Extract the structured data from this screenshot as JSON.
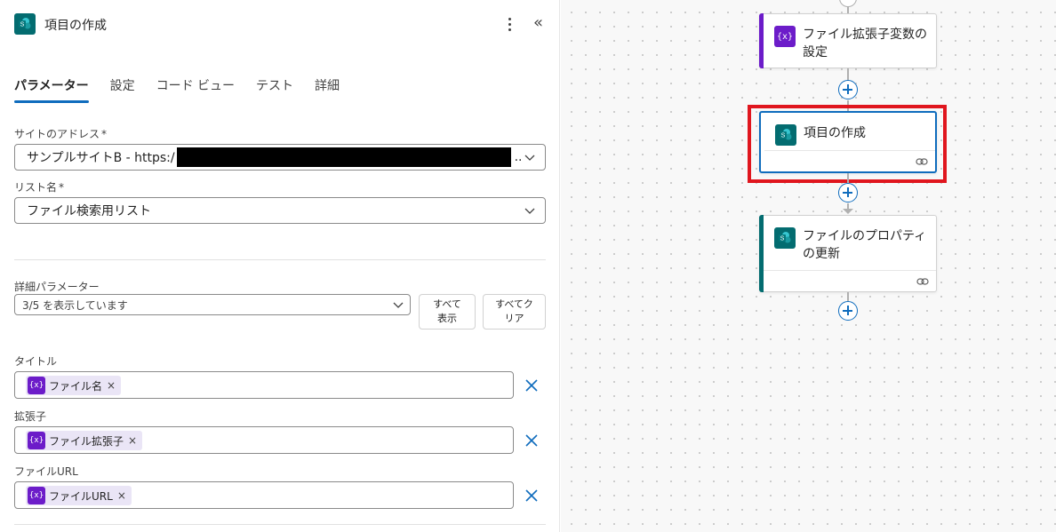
{
  "panel": {
    "title": "項目の作成",
    "tabs": [
      {
        "label": "パラメーター",
        "active": true
      },
      {
        "label": "設定",
        "active": false
      },
      {
        "label": "コード ビュー",
        "active": false
      },
      {
        "label": "テスト",
        "active": false
      },
      {
        "label": "詳細",
        "active": false
      }
    ],
    "site": {
      "label": "サイトのアドレス",
      "required_mark": "*",
      "value_prefix": "サンプルサイトB - https:/",
      "value_suffix": ".."
    },
    "list": {
      "label": "リスト名",
      "required_mark": "*",
      "value": "ファイル検索用リスト"
    },
    "advanced": {
      "label": "詳細パラメーター",
      "value": "3/5 を表示しています",
      "show_all": "すべて\n表示",
      "clear_all": "すべてク\nリア"
    },
    "fields": [
      {
        "label": "タイトル",
        "token": "ファイル名"
      },
      {
        "label": "拡張子",
        "token": "ファイル拡張子"
      },
      {
        "label": "ファイルURL",
        "token": "ファイルURL"
      }
    ],
    "var_icon_text": "{x}",
    "token_remove": "×"
  },
  "canvas": {
    "cards": [
      {
        "title": "ファイル拡張子変数の設定",
        "type": "variable",
        "accent": "#6c1cc9"
      },
      {
        "title": "項目の作成",
        "type": "sharepoint",
        "accent": "#0f6cbd",
        "selected": true
      },
      {
        "title": "ファイルのプロパティの更新",
        "type": "sharepoint",
        "accent": "#036c70"
      }
    ]
  },
  "colors": {
    "accent": "#0f6cbd",
    "sharepoint": "#036c70",
    "variable": "#6c1cc9",
    "highlight": "#e0161e"
  }
}
